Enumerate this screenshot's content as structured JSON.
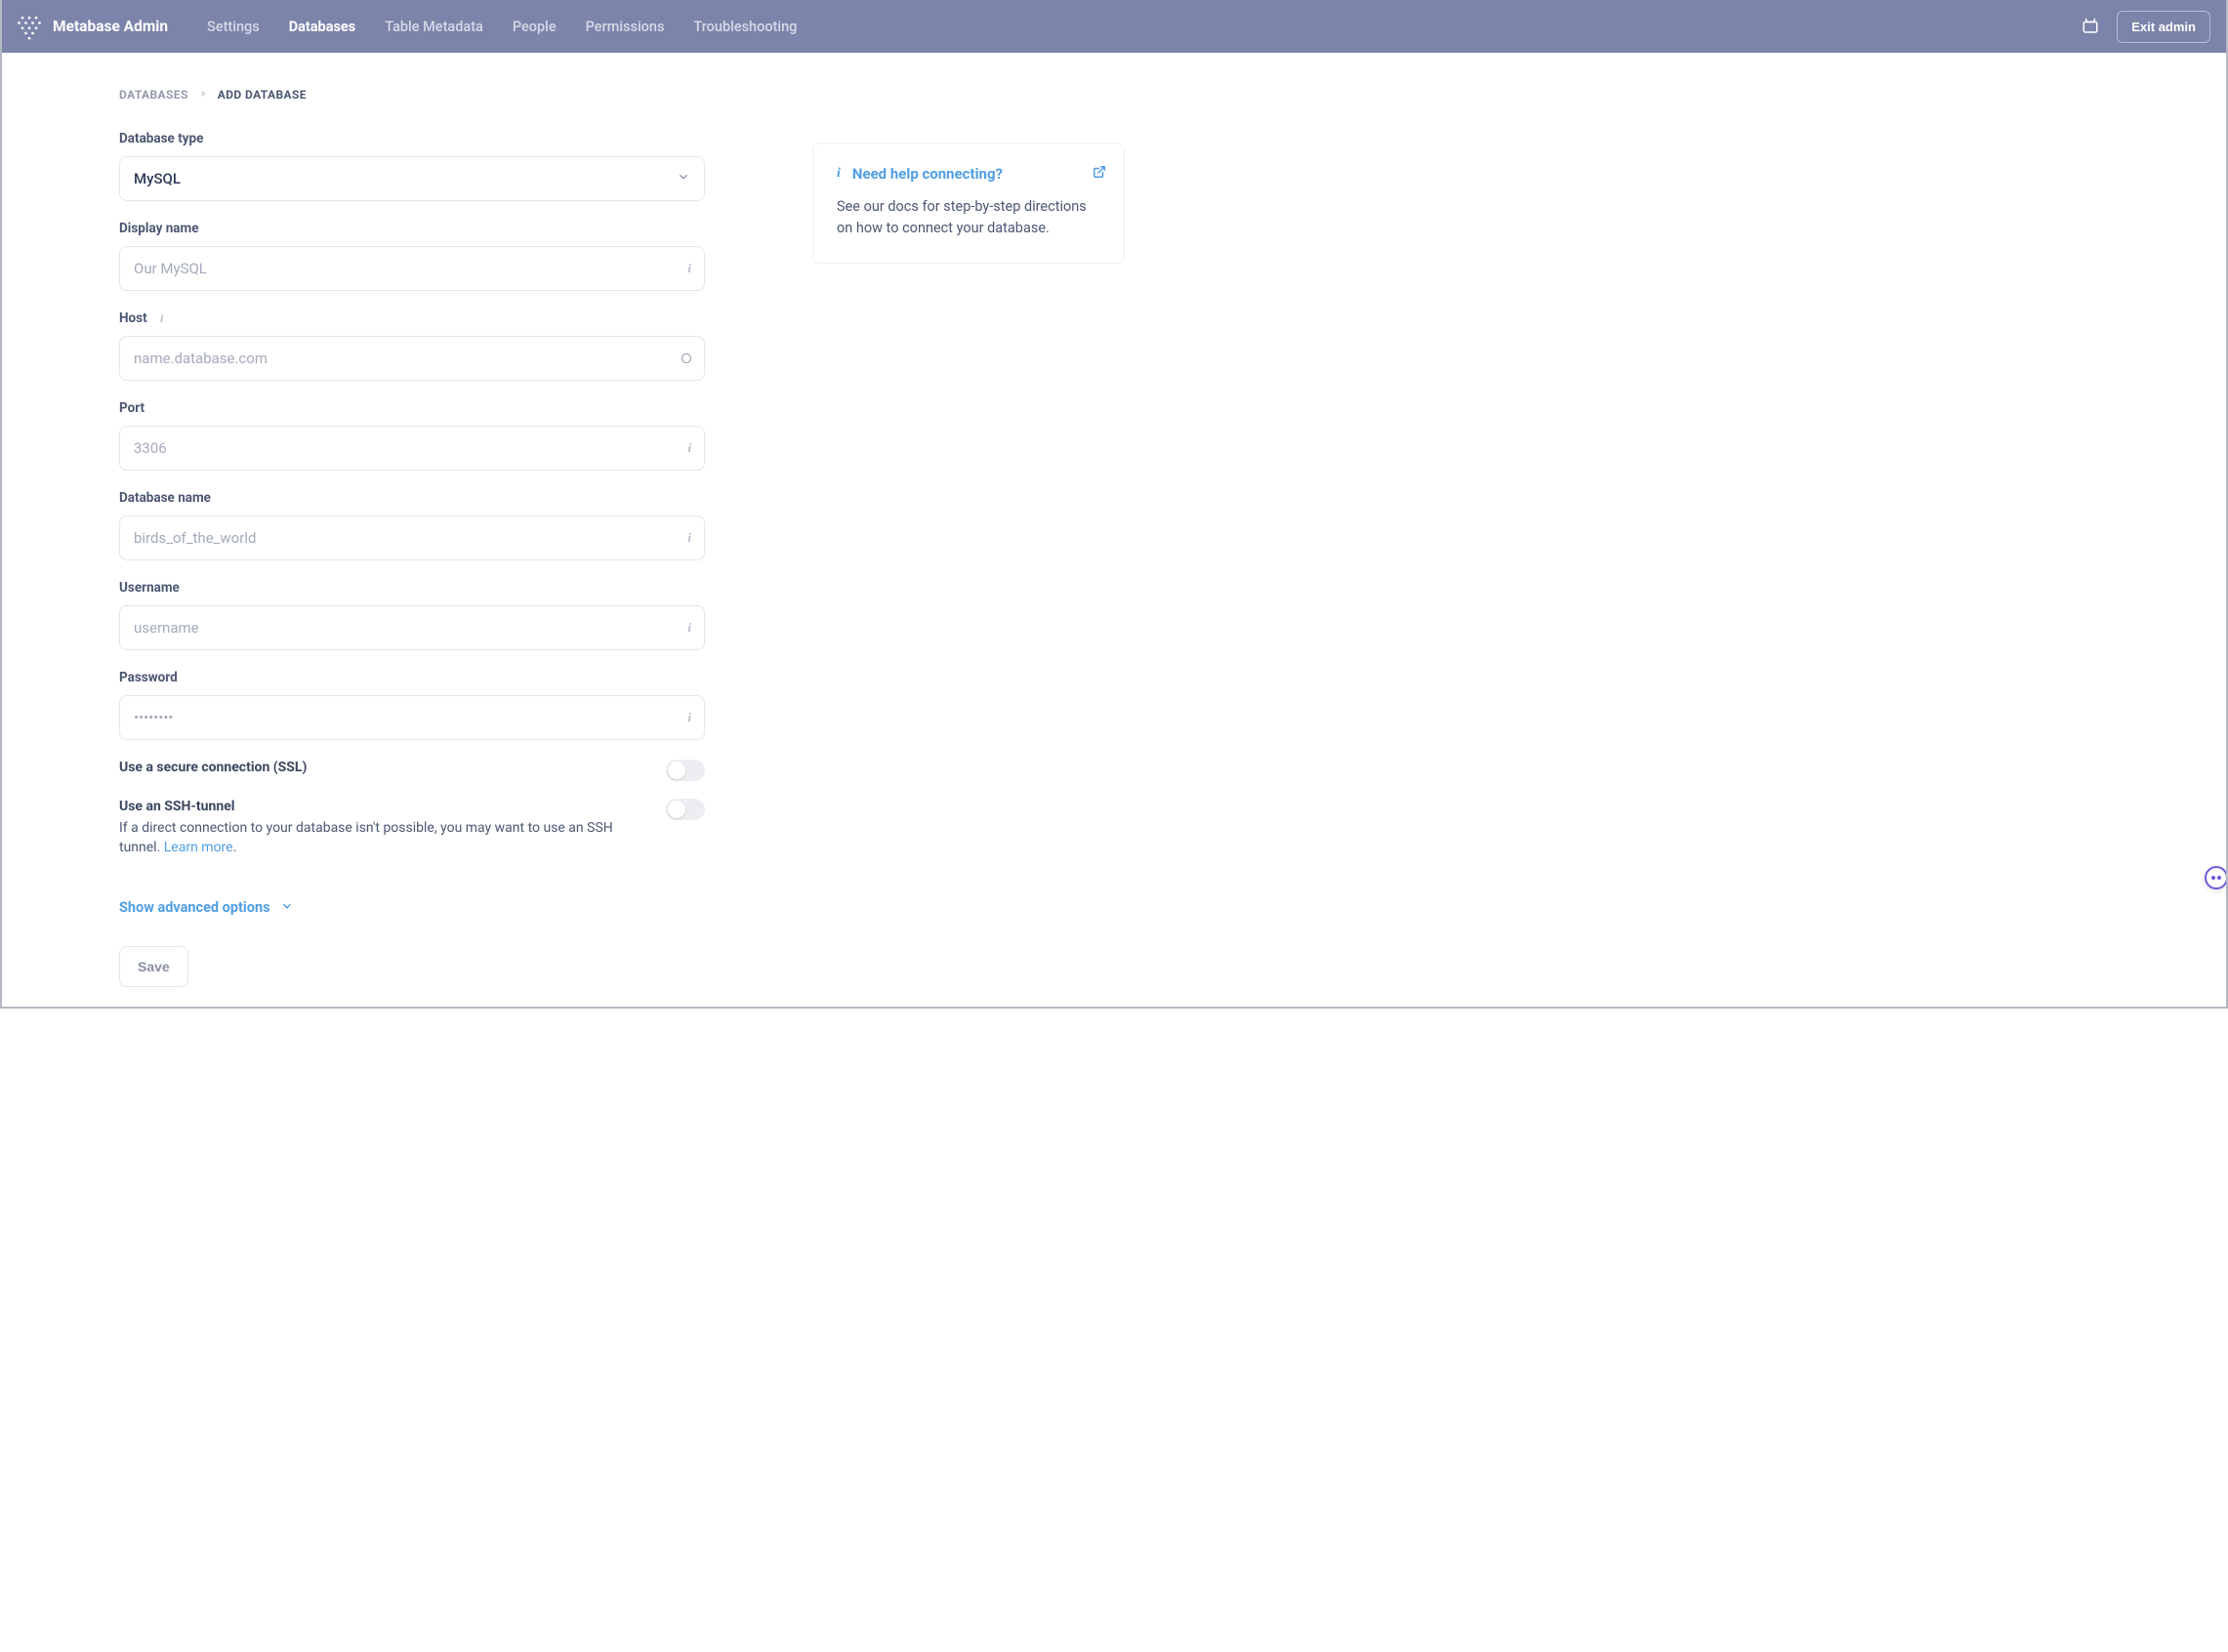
{
  "header": {
    "brand": "Metabase Admin",
    "nav": [
      "Settings",
      "Databases",
      "Table Metadata",
      "People",
      "Permissions",
      "Troubleshooting"
    ],
    "active_index": 1,
    "exit_label": "Exit admin"
  },
  "breadcrumb": {
    "root": "DATABASES",
    "current": "ADD DATABASE"
  },
  "form": {
    "db_type": {
      "label": "Database type",
      "value": "MySQL"
    },
    "display_name": {
      "label": "Display name",
      "placeholder": "Our MySQL",
      "value": ""
    },
    "host": {
      "label": "Host",
      "placeholder": "name.database.com",
      "value": ""
    },
    "port": {
      "label": "Port",
      "placeholder": "3306",
      "value": ""
    },
    "db_name": {
      "label": "Database name",
      "placeholder": "birds_of_the_world",
      "value": ""
    },
    "username": {
      "label": "Username",
      "placeholder": "username",
      "value": ""
    },
    "password": {
      "label": "Password",
      "placeholder": "••••••••",
      "value": ""
    },
    "ssl": {
      "label": "Use a secure connection (SSL)",
      "on": false
    },
    "ssh": {
      "label": "Use an SSH-tunnel",
      "desc": "If a direct connection to your database isn't possible, you may want to use an SSH tunnel.",
      "learn_more": "Learn more",
      "on": false
    },
    "advanced": "Show advanced options",
    "save": "Save"
  },
  "help": {
    "title": "Need help connecting?",
    "body": "See our docs for step-by-step directions on how to connect your database."
  }
}
